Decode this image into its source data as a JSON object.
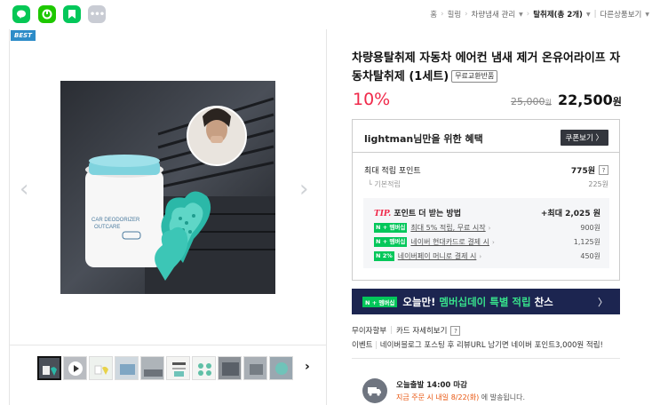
{
  "share": {
    "line_label": "LINE",
    "band_label": "band",
    "blog_label": "blog",
    "more_label": "•••"
  },
  "breadcrumb": {
    "home": "홈",
    "level1": "힐링",
    "level2": "차량냄새 관리",
    "level3": "탈취제(총 2개)",
    "level4": "다른상품보기"
  },
  "gallery": {
    "best_badge": "BEST",
    "product_text_1": "CAR DEODORIZER",
    "product_text_2": "OUTCARE",
    "product_text_3": "ESSENTIAL OIL FOR\nCAR DEODORIZATION",
    "prev_icon": "chevron-left",
    "next_icon": "chevron-right",
    "thumb_count": 10
  },
  "product": {
    "title": "차량용탈취제 자동차 에어컨 냄새 제거 온유어라이프 자동차탈취제 (1세트)",
    "return_badge": "무료교환반품",
    "discount": "10%",
    "original_price": "25,000",
    "original_price_unit": "원",
    "price": "22,500",
    "price_unit": "원"
  },
  "benefit": {
    "heading": "lightman님만을 위한 혜택",
    "coupon_button": "쿠폰보기 〉",
    "max_point_label": "최대 적립 포인트",
    "max_point_value": "775원",
    "base_label": "기본적립",
    "base_value": "225원",
    "tip_prefix": "TIP.",
    "tip_heading": "포인트 더 받는 방법",
    "tip_max": "+최대 2,025 원",
    "rows": [
      {
        "badge": "N + 멤버십",
        "text": "최대 5% 적립, 무료 시작",
        "amount": "900원"
      },
      {
        "badge": "N + 멤버십",
        "text": "네이버 현대카드로 결제 시",
        "amount": "1,125원"
      },
      {
        "badge": "N 2%",
        "text": "네이버페이 머니로 결제 시",
        "amount": "450원"
      }
    ]
  },
  "banner": {
    "badge": "N + 멤버십",
    "text_prefix": "오늘만! ",
    "text_highlight": "멤버십데이 특별 적립",
    "text_suffix": " 찬스",
    "arrow": "〉"
  },
  "payment": {
    "installment": "무이자할부",
    "card_info": "카드 자세히보기",
    "event_label": "이벤트",
    "event_text": "네이버블로그 포스팅 후 리뷰URL 남기면 네이버 포인트3,000원 적립!"
  },
  "shipping": {
    "title": "오늘출발 14:00 마감",
    "sub_highlight": "지금 주문 시 내일 8/22(화)",
    "sub_suffix": " 에 발송됩니다."
  },
  "colors": {
    "accent_red": "#f0294a",
    "naver_green": "#03c75a",
    "banner_navy": "#1c2550"
  }
}
